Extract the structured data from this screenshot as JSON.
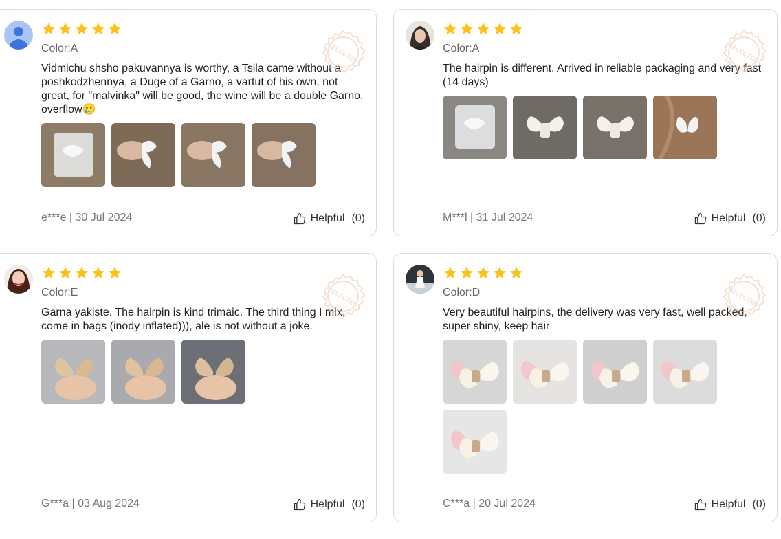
{
  "stamp_text": "SELECTED",
  "colors": {
    "star": "#fbc21b",
    "stamp": "#e7c9b4",
    "card_border": "#dcdcdc",
    "muted_text": "#777777"
  },
  "reviews": [
    {
      "avatar": "default-user-icon",
      "stars": 5,
      "color": "Color:A",
      "text": "Vidmichu shsho pakuvannya is worthy, a Tsila came without a poshkodzhennya, a Duge of a Garno, a vartut of his own, not great, for \"malvinka\" will be good, the wine will be a double Garno, overflow🥲",
      "photo_count": 4,
      "user": "e***e",
      "date": "30 Jul 2024",
      "helpful_label": "Helpful",
      "helpful_count": "(0)"
    },
    {
      "avatar": "user-photo",
      "stars": 5,
      "color": "Color:A",
      "text": "The hairpin is different. Arrived in reliable packaging and very fast (14 days)",
      "photo_count": 4,
      "user": "M***l",
      "date": "31 Jul 2024",
      "helpful_label": "Helpful",
      "helpful_count": "(0)"
    },
    {
      "avatar": "user-photo",
      "stars": 5,
      "color": "Color:E",
      "text": "Garna yakiste. The hairpin is kind trimaic. The third thing I mix, come in bags (inody inflated))), ale is not without a joke.",
      "photo_count": 3,
      "user": "G***a",
      "date": "03 Aug 2024",
      "helpful_label": "Helpful",
      "helpful_count": "(0)"
    },
    {
      "avatar": "user-photo",
      "stars": 5,
      "color": "Color:D",
      "text": "Very beautiful hairpins, the delivery was very fast, well packed, super shiny, keep hair",
      "photo_count": 5,
      "user": "C***a",
      "date": "20 Jul 2024",
      "helpful_label": "Helpful",
      "helpful_count": "(0)"
    }
  ]
}
